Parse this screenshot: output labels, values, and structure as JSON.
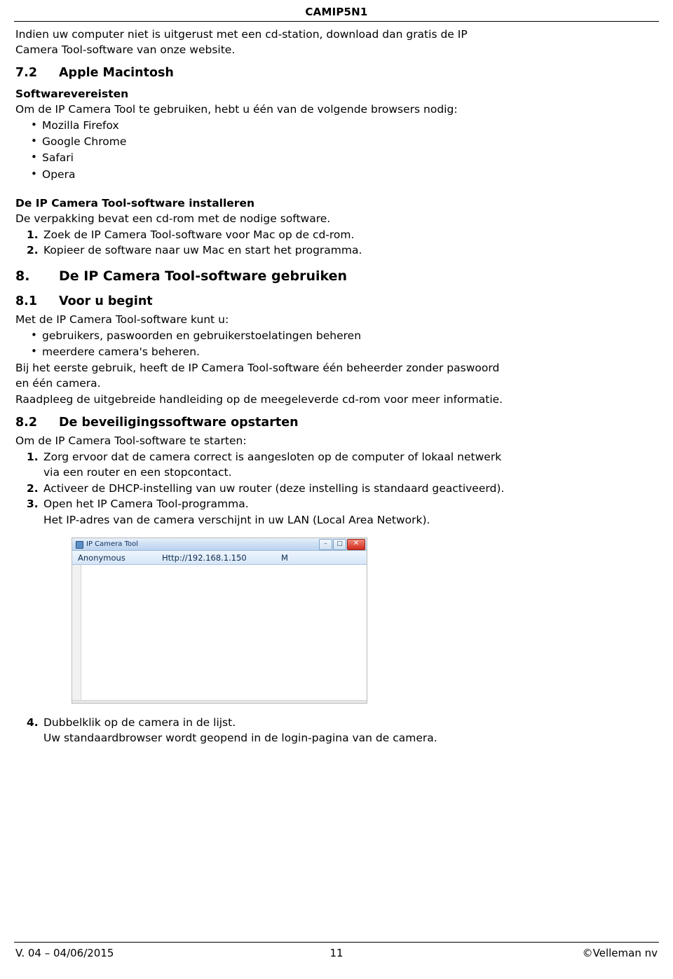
{
  "header": {
    "title": "CAMIP5N1"
  },
  "footer": {
    "version": "V. 04 – 04/06/2015",
    "page": "11",
    "copyright": "©Velleman nv"
  },
  "content": {
    "intro": "Indien uw computer niet is uitgerust met een cd-station, download dan gratis de IP Camera Tool-software van onze website.",
    "section_72": {
      "number": "7.2",
      "title": "Apple Macintosh"
    },
    "software_requirements_heading": "Softwarevereisten",
    "software_requirements_intro": "Om de IP Camera Tool te gebruiken, hebt u één van de volgende browsers nodig:",
    "browsers": [
      "Mozilla Firefox",
      "Google Chrome",
      "Safari",
      "Opera"
    ],
    "install_heading": "De IP Camera Tool-software installeren",
    "install_intro": "De verpakking bevat een cd-rom met de nodige software.",
    "install_steps": [
      {
        "marker": "1.",
        "text": "Zoek de IP Camera Tool-software voor Mac op de cd-rom."
      },
      {
        "marker": "2.",
        "text": "Kopieer de software naar uw Mac en start het programma."
      }
    ],
    "section_8": {
      "number": "8.",
      "title": "De IP Camera Tool-software gebruiken"
    },
    "section_81": {
      "number": "8.1",
      "title": "Voor u begint"
    },
    "begin_intro": "Met de IP Camera Tool-software kunt u:",
    "begin_bullets": [
      "gebruikers, paswoorden en gebruikerstoelatingen beheren",
      "meerdere camera's beheren."
    ],
    "begin_para1": "Bij het eerste gebruik, heeft de IP Camera Tool-software één beheerder zonder paswoord en één camera.",
    "begin_para2": "Raadpleeg de uitgebreide handleiding op de meegeleverde cd-rom voor meer informatie.",
    "section_82": {
      "number": "8.2",
      "title": "De beveiligingssoftware opstarten"
    },
    "start_intro": "Om de IP Camera Tool-software te starten:",
    "start_steps": [
      {
        "marker": "1.",
        "text": "Zorg ervoor dat de camera correct is aangesloten op de computer of lokaal netwerk via een router en een stopcontact."
      },
      {
        "marker": "2.",
        "text": "Activeer de DHCP-instelling van uw router (deze instelling is standaard geactiveerd)."
      },
      {
        "marker": "3.",
        "text": "Open het IP Camera Tool-programma."
      }
    ],
    "start_step3_note": "Het IP-adres van de camera verschijnt in uw LAN (Local Area Network).",
    "after_steps": [
      {
        "marker": "4.",
        "text": "Dubbelklik op de camera in de lijst."
      }
    ],
    "after_note": "Uw standaardbrowser wordt geopend in de login-pagina van de camera."
  },
  "figure": {
    "window_title": "IP Camera Tool",
    "buttons": {
      "minimize": "–",
      "maximize": "□",
      "close": "✕"
    },
    "columns": {
      "name": "Anonymous",
      "address": "Http://192.168.1.150",
      "flag": "M"
    }
  }
}
